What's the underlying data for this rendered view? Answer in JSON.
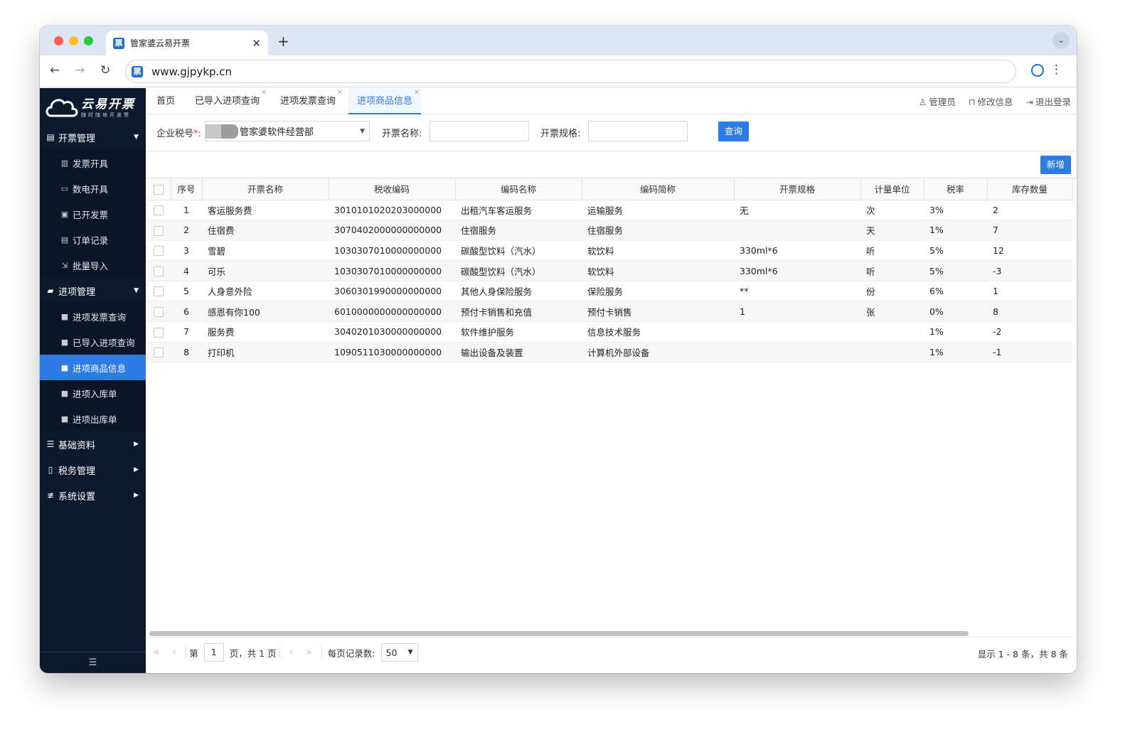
{
  "browser": {
    "tab_title": "管家婆云易开票",
    "tab_favicon": "票",
    "url": "www.gjpykp.cn"
  },
  "logo": {
    "main": "云易开票",
    "sub": "随时随地开发票"
  },
  "sidebar": {
    "groups": [
      {
        "label": "开票管理",
        "icon": "invoice-icon",
        "expanded": true
      },
      {
        "label": "进项管理",
        "icon": "folder-icon",
        "expanded": true
      },
      {
        "label": "基础资料",
        "icon": "list-icon",
        "expanded": false
      },
      {
        "label": "税务管理",
        "icon": "bottle-icon",
        "expanded": false
      },
      {
        "label": "系统设置",
        "icon": "sliders-icon",
        "expanded": false
      }
    ],
    "invoice_items": [
      "发票开具",
      "数电开具",
      "已开发票",
      "订单记录",
      "批量导入"
    ],
    "input_items": [
      "进项发票查询",
      "已导入进项查询",
      "进项商品信息",
      "进项入库单",
      "进项出库单"
    ],
    "active_item": "进项商品信息",
    "collapse_glyph": "☰"
  },
  "page_tabs": [
    "首页",
    "已导入进项查询",
    "进项发票查询",
    "进项商品信息"
  ],
  "userbar": {
    "admin": "管理员",
    "edit": "修改信息",
    "logout": "退出登录"
  },
  "filters": {
    "tax_label": "企业税号",
    "tax_required": "*:",
    "tax_value": "管家婆软件经营部",
    "name_label": "开票名称:",
    "spec_label": "开票规格:",
    "query_button": "查询"
  },
  "toolbar": {
    "add_button": "新增"
  },
  "table": {
    "columns": [
      "序号",
      "开票名称",
      "税收编码",
      "编码名称",
      "编码简称",
      "开票规格",
      "计量单位",
      "税率",
      "库存数量"
    ],
    "rows": [
      [
        "1",
        "客运服务费",
        "3010101020203000000",
        "出租汽车客运服务",
        "运输服务",
        "无",
        "次",
        "3%",
        "2"
      ],
      [
        "2",
        "住宿费",
        "3070402000000000000",
        "住宿服务",
        "住宿服务",
        "",
        "天",
        "1%",
        "7"
      ],
      [
        "3",
        "雪碧",
        "1030307010000000000",
        "碳酸型饮料（汽水）",
        "软饮料",
        "330ml*6",
        "听",
        "5%",
        "12"
      ],
      [
        "4",
        "可乐",
        "1030307010000000000",
        "碳酸型饮料（汽水）",
        "软饮料",
        "330ml*6",
        "听",
        "5%",
        "-3"
      ],
      [
        "5",
        "人身意外险",
        "3060301990000000000",
        "其他人身保险服务",
        "保险服务",
        "**",
        "份",
        "6%",
        "1"
      ],
      [
        "6",
        "感恩有你100",
        "6010000000000000000",
        "预付卡销售和充值",
        "预付卡销售",
        "1",
        "张",
        "0%",
        "8"
      ],
      [
        "7",
        "服务费",
        "3040201030000000000",
        "软件维护服务",
        "信息技术服务",
        "",
        "",
        "1%",
        "-2"
      ],
      [
        "8",
        "打印机",
        "1090511030000000000",
        "输出设备及装置",
        "计算机外部设备",
        "",
        "",
        "1%",
        "-1"
      ]
    ]
  },
  "pager": {
    "page_prefix": "第",
    "page": "1",
    "page_suffix": "页，共 1 页",
    "size_label": "每页记录数:",
    "size": "50",
    "info": "显示 1 - 8 条，共 8 条"
  },
  "colors": {
    "accent": "#2c7be5",
    "sidebar": "#0b1a2e"
  }
}
